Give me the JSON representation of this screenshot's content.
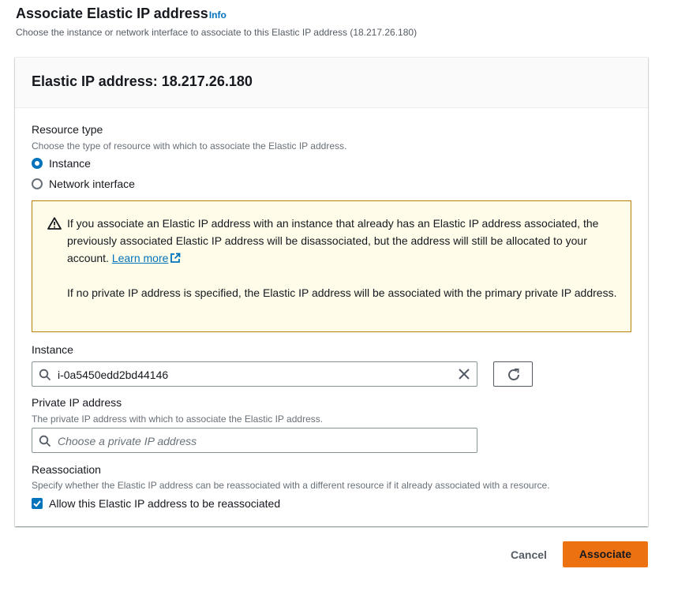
{
  "header": {
    "title": "Associate Elastic IP address",
    "info_label": "Info",
    "description": "Choose the instance or network interface to associate to this Elastic IP address (18.217.26.180)"
  },
  "card": {
    "title": "Elastic IP address: 18.217.26.180"
  },
  "resource_type": {
    "label": "Resource type",
    "description": "Choose the type of resource with which to associate the Elastic IP address.",
    "options": [
      {
        "label": "Instance",
        "selected": true
      },
      {
        "label": "Network interface",
        "selected": false
      }
    ]
  },
  "alert": {
    "type": "warning",
    "paragraph1": "If you associate an Elastic IP address with an instance that already has an Elastic IP address associated, the previously associated Elastic IP address will be disassociated, but the address will still be allocated to your account.",
    "learn_more": "Learn more",
    "paragraph2": "If no private IP address is specified, the Elastic IP address will be associated with the primary private IP address."
  },
  "instance": {
    "label": "Instance",
    "value": "i-0a5450edd2bd44146"
  },
  "private_ip": {
    "label": "Private IP address",
    "description": "The private IP address with which to associate the Elastic IP address.",
    "placeholder": "Choose a private IP address",
    "value": ""
  },
  "reassociation": {
    "label": "Reassociation",
    "description": "Specify whether the Elastic IP address can be reassociated with a different resource if it already associated with a resource.",
    "checkbox_label": "Allow this Elastic IP address to be reassociated",
    "checked": true
  },
  "footer": {
    "cancel_label": "Cancel",
    "associate_label": "Associate"
  },
  "colors": {
    "accent": "#0073bb",
    "primary_button": "#ec7211",
    "warning_border": "#b18300",
    "warning_bg": "#fffce9"
  }
}
